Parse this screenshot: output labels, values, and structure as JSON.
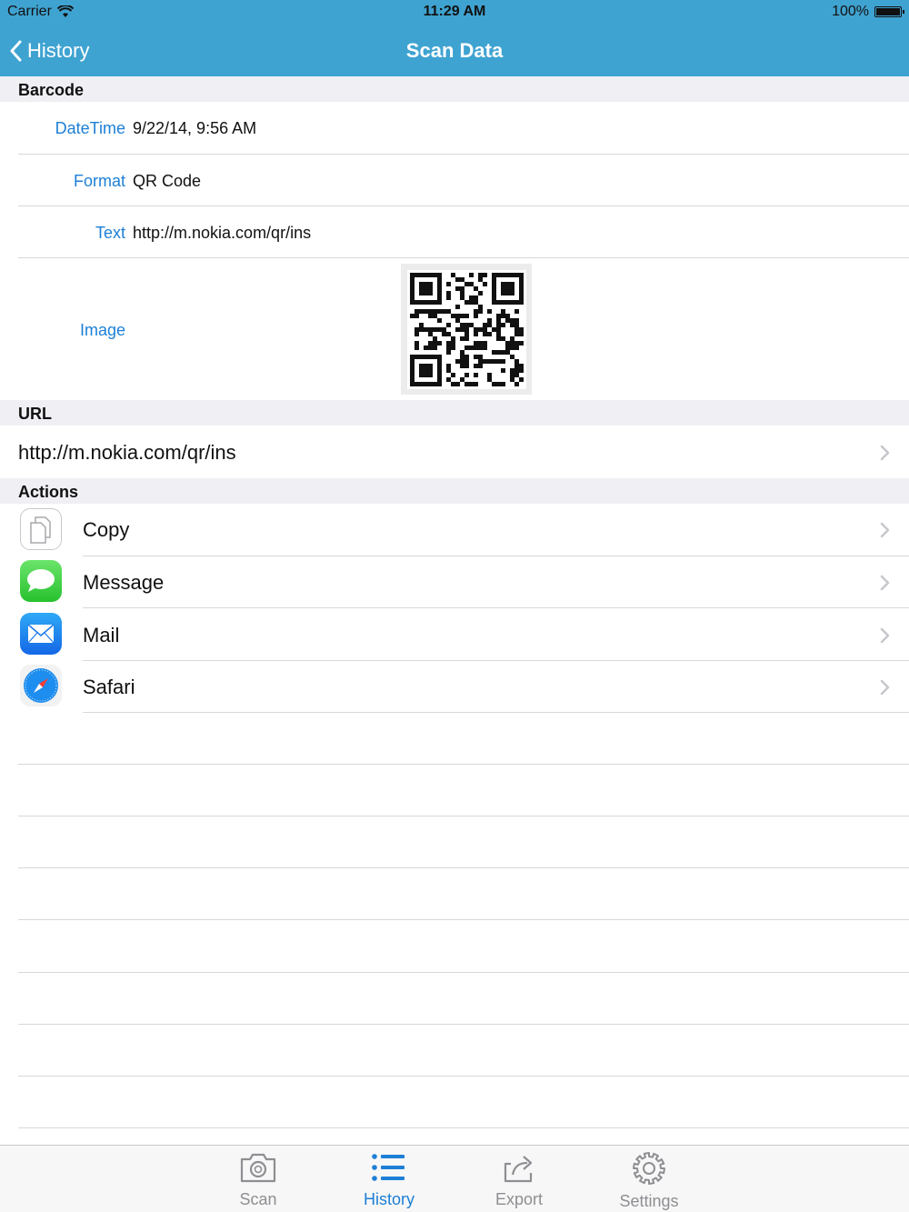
{
  "status_bar": {
    "carrier": "Carrier",
    "time": "11:29 AM",
    "battery": "100%"
  },
  "nav": {
    "back_label": "History",
    "title": "Scan Data"
  },
  "barcode_section": {
    "header": "Barcode",
    "rows": [
      {
        "label": "DateTime",
        "value": "9/22/14, 9:56 AM"
      },
      {
        "label": "Format",
        "value": "QR Code"
      },
      {
        "label": "Text",
        "value": "http://m.nokia.com/qr/ins"
      },
      {
        "label": "Image",
        "value": ""
      }
    ]
  },
  "url_section": {
    "header": "URL",
    "value": "http://m.nokia.com/qr/ins"
  },
  "actions_section": {
    "header": "Actions",
    "items": [
      {
        "label": "Copy",
        "icon": "copy-icon"
      },
      {
        "label": "Message",
        "icon": "message-icon"
      },
      {
        "label": "Mail",
        "icon": "mail-icon"
      },
      {
        "label": "Safari",
        "icon": "safari-icon"
      }
    ]
  },
  "tabbar": {
    "tabs": [
      {
        "label": "Scan",
        "icon": "camera-icon",
        "active": false
      },
      {
        "label": "History",
        "icon": "list-icon",
        "active": true
      },
      {
        "label": "Export",
        "icon": "share-icon",
        "active": false
      },
      {
        "label": "Settings",
        "icon": "gear-icon",
        "active": false
      }
    ]
  },
  "colors": {
    "nav_bar": "#3fa3d1",
    "accent": "#1d7fd6",
    "section_bg": "#efeff4",
    "inactive_tab": "#8e8e93"
  }
}
